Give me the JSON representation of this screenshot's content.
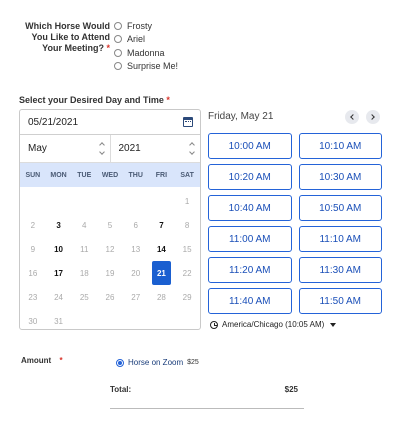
{
  "horse_question": {
    "label": "Which Horse Would You Like to Attend Your Meeting?",
    "required_mark": "*",
    "options": [
      {
        "label": "Frosty",
        "checked": false
      },
      {
        "label": "Ariel",
        "checked": false
      },
      {
        "label": "Madonna",
        "checked": false
      },
      {
        "label": "Surprise Me!",
        "checked": false
      }
    ]
  },
  "datetime": {
    "label": "Select your Desired Day and Time",
    "required_mark": "*",
    "date_value": "05/21/2021",
    "month": "May",
    "year": "2021",
    "weekdays": [
      "SUN",
      "MON",
      "TUE",
      "WED",
      "THU",
      "FRI",
      "SAT"
    ],
    "days": [
      {
        "d": "",
        "s": "blank"
      },
      {
        "d": "",
        "s": "blank"
      },
      {
        "d": "",
        "s": "blank"
      },
      {
        "d": "",
        "s": "blank"
      },
      {
        "d": "",
        "s": "blank"
      },
      {
        "d": "",
        "s": "blank"
      },
      {
        "d": "1",
        "s": "off"
      },
      {
        "d": "2",
        "s": "off"
      },
      {
        "d": "3",
        "s": "avail"
      },
      {
        "d": "4",
        "s": "off"
      },
      {
        "d": "5",
        "s": "off"
      },
      {
        "d": "6",
        "s": "off"
      },
      {
        "d": "7",
        "s": "avail"
      },
      {
        "d": "8",
        "s": "off"
      },
      {
        "d": "9",
        "s": "off"
      },
      {
        "d": "10",
        "s": "avail"
      },
      {
        "d": "11",
        "s": "off"
      },
      {
        "d": "12",
        "s": "off"
      },
      {
        "d": "13",
        "s": "off"
      },
      {
        "d": "14",
        "s": "avail"
      },
      {
        "d": "15",
        "s": "off"
      },
      {
        "d": "16",
        "s": "off"
      },
      {
        "d": "17",
        "s": "avail"
      },
      {
        "d": "18",
        "s": "off"
      },
      {
        "d": "19",
        "s": "off"
      },
      {
        "d": "20",
        "s": "off"
      },
      {
        "d": "21",
        "s": "selected"
      },
      {
        "d": "22",
        "s": "off"
      },
      {
        "d": "23",
        "s": "off"
      },
      {
        "d": "24",
        "s": "off"
      },
      {
        "d": "25",
        "s": "off"
      },
      {
        "d": "26",
        "s": "off"
      },
      {
        "d": "27",
        "s": "off"
      },
      {
        "d": "28",
        "s": "off"
      },
      {
        "d": "29",
        "s": "off"
      },
      {
        "d": "30",
        "s": "off"
      },
      {
        "d": "31",
        "s": "off"
      }
    ],
    "day_title": "Friday, May 21",
    "time_slots": [
      "10:00 AM",
      "10:10 AM",
      "10:20 AM",
      "10:30 AM",
      "10:40 AM",
      "10:50 AM",
      "11:00 AM",
      "11:10 AM",
      "11:20 AM",
      "11:30 AM",
      "11:40 AM",
      "11:50 AM"
    ],
    "timezone": "America/Chicago (10:05 AM)"
  },
  "amount": {
    "label": "Amount",
    "required_mark": "*",
    "option_label": "Horse on Zoom",
    "option_price": "$25",
    "option_checked": true,
    "total_label": "Total:",
    "total_value": "$25"
  },
  "colors": {
    "accent": "#2463d8",
    "selected_day": "#1a5fd0",
    "weekday_band": "#d9e5fb",
    "required": "#d9342b"
  },
  "icons": [
    "calendar-icon",
    "chevron-up-icon",
    "chevron-down-icon",
    "chevron-left-icon",
    "chevron-right-icon",
    "clock-icon",
    "caret-down-icon"
  ]
}
